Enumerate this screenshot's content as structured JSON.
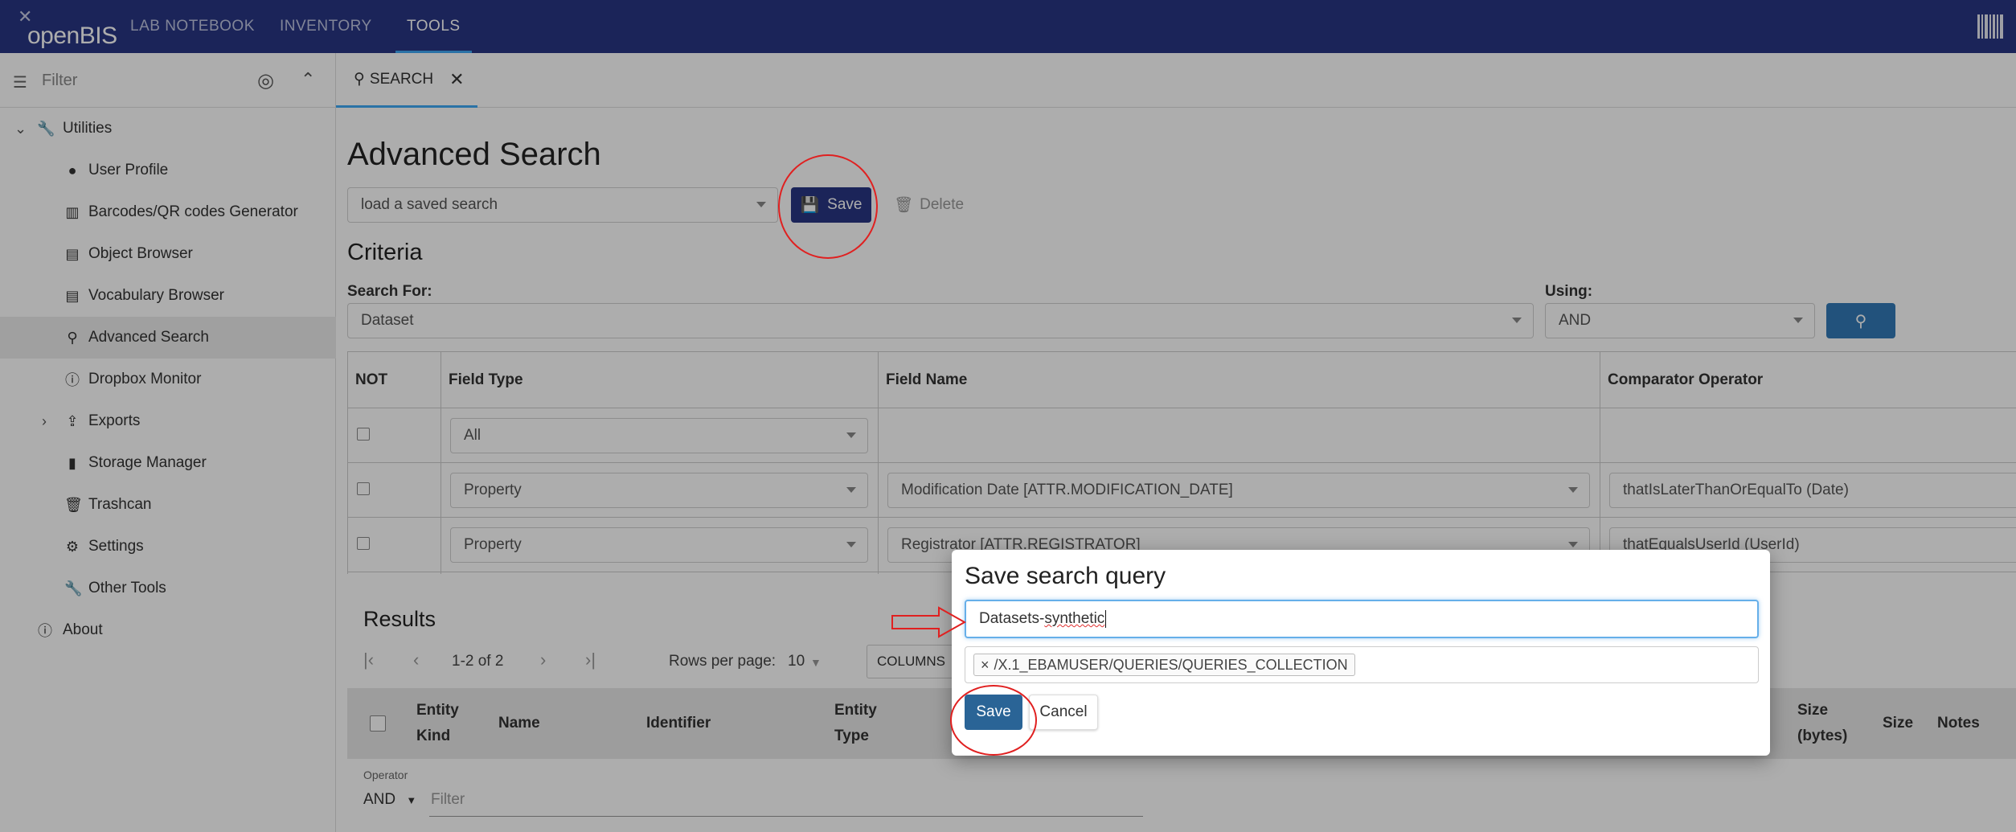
{
  "app": {
    "logo_text": "openBIS"
  },
  "topnav": {
    "items": [
      "LAB NOTEBOOK",
      "INVENTORY",
      "TOOLS"
    ]
  },
  "sidebar": {
    "filter_placeholder": "Filter",
    "items": [
      {
        "label": "Utilities",
        "icon": "wrench-icon"
      },
      {
        "label": "User Profile",
        "icon": "person-icon"
      },
      {
        "label": "Barcodes/QR codes Generator",
        "icon": "barcode-icon"
      },
      {
        "label": "Object Browser",
        "icon": "list-icon"
      },
      {
        "label": "Vocabulary Browser",
        "icon": "list-icon"
      },
      {
        "label": "Advanced Search",
        "icon": "search-icon"
      },
      {
        "label": "Dropbox Monitor",
        "icon": "info-icon"
      },
      {
        "label": "Exports",
        "icon": "export-icon"
      },
      {
        "label": "Storage Manager",
        "icon": "file-icon"
      },
      {
        "label": "Trashcan",
        "icon": "trash-icon"
      },
      {
        "label": "Settings",
        "icon": "gear-icon"
      },
      {
        "label": "Other Tools",
        "icon": "wrench-icon"
      },
      {
        "label": "About",
        "icon": "info-icon"
      }
    ]
  },
  "tab": {
    "label": "SEARCH"
  },
  "page": {
    "title": "Advanced Search",
    "saved_search_placeholder": "load a saved search",
    "save_label": "Save",
    "delete_label": "Delete",
    "criteria_title": "Criteria",
    "search_for_label": "Search For:",
    "search_for_value": "Dataset",
    "using_label": "Using:",
    "using_value": "AND"
  },
  "criteria": {
    "headers": [
      "NOT",
      "Field Type",
      "Field Name",
      "Comparator Operator"
    ],
    "rows": [
      {
        "field_type": "All",
        "field_name": "",
        "comparator": ""
      },
      {
        "field_type": "Property",
        "field_name": "Modification Date [ATTR.MODIFICATION_DATE]",
        "comparator": "thatIsLaterThanOrEqualTo (Date)"
      },
      {
        "field_type": "Property",
        "field_name": "Registrator [ATTR.REGISTRATOR]",
        "comparator": "thatEqualsUserId (UserId)"
      }
    ]
  },
  "results": {
    "title": "Results",
    "range": "1-2 of 2",
    "rows_per_page_label": "Rows per page:",
    "rows_per_page_value": "10",
    "columns_label": "COLUMNS",
    "headers": [
      "Entity\nKind",
      "Name",
      "Identifier",
      "Entity\nType",
      "Size\n(bytes)",
      "Size",
      "Notes"
    ],
    "operator_label": "Operator",
    "operator_value": "AND",
    "filter_placeholder": "Filter"
  },
  "modal": {
    "title": "Save search query",
    "name_value_prefix": "Datasets-",
    "name_value_misspelled": "synthetic",
    "collection_tag": "/X.1_EBAMUSER/QUERIES/QUERIES_COLLECTION",
    "save_label": "Save",
    "cancel_label": "Cancel"
  },
  "colors": {
    "topbar": "#293683",
    "primary_button": "#293683",
    "modal_save": "#2a6496",
    "search_button": "#337ab7",
    "annotation": "#e02020"
  }
}
